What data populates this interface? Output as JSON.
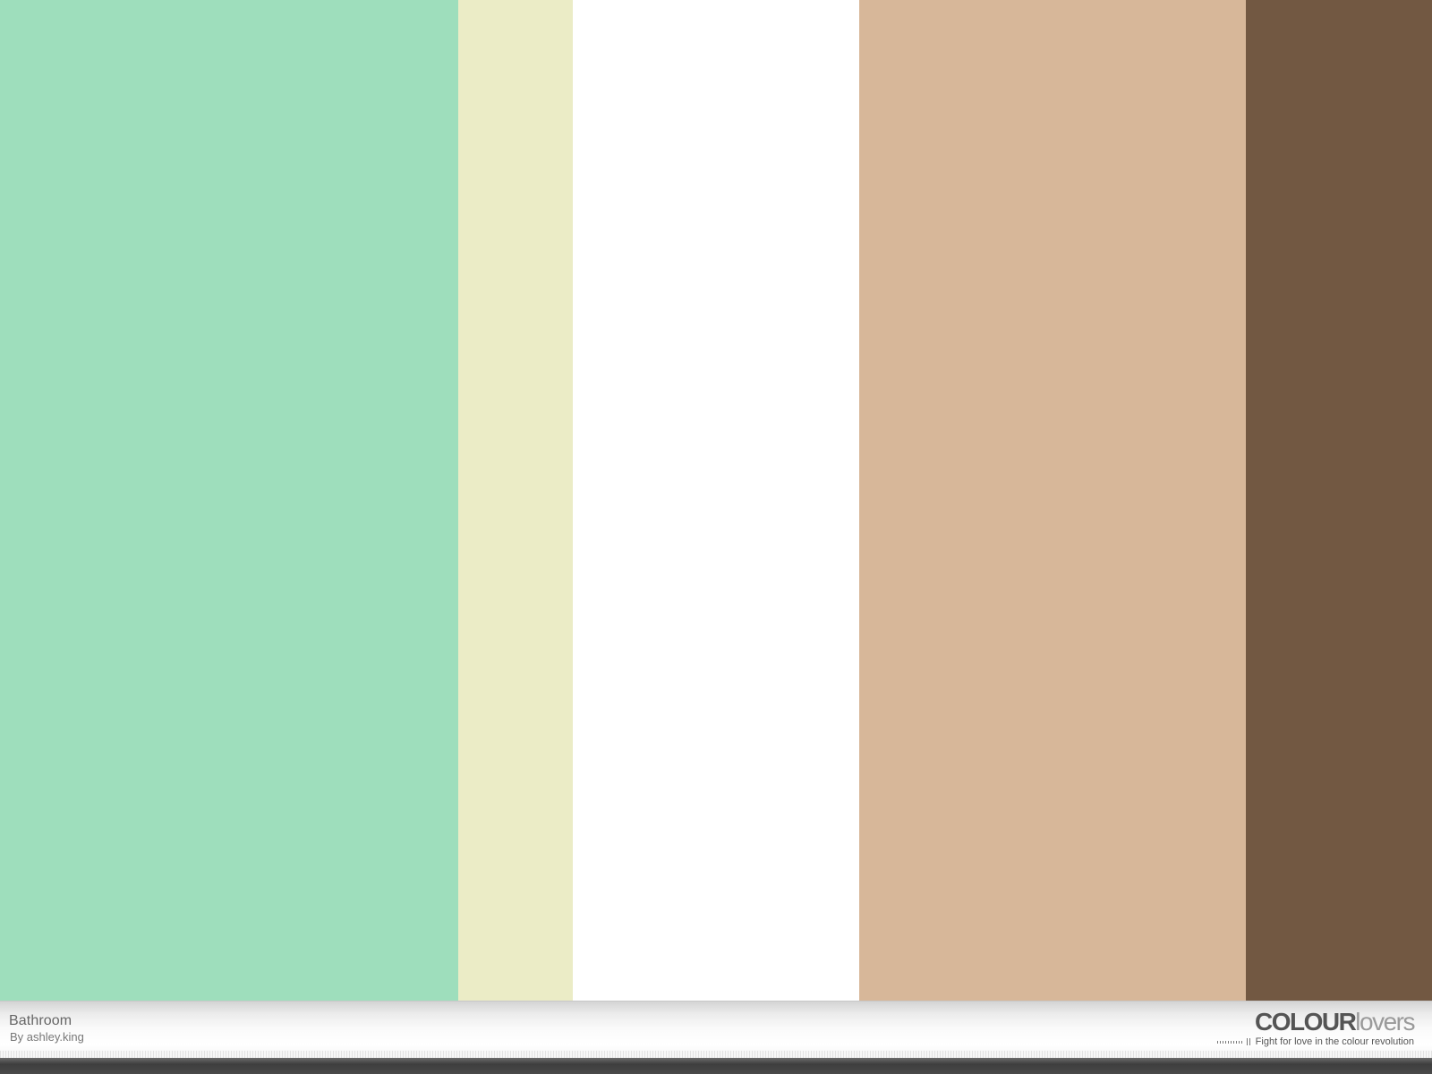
{
  "palette": {
    "title": "Bathroom",
    "author": "By ashley.king",
    "swatches": [
      {
        "color": "#9EDEBC",
        "share": 0.32
      },
      {
        "color": "#EBECC6",
        "share": 0.08
      },
      {
        "color": "#FFFFFF",
        "share": 0.2
      },
      {
        "color": "#D7B799",
        "share": 0.27
      },
      {
        "color": "#725842",
        "share": 0.13
      }
    ]
  },
  "branding": {
    "logo_bold": "COLOUR",
    "logo_light": "lovers",
    "tagline": "Fight for love in the colour revolution"
  }
}
